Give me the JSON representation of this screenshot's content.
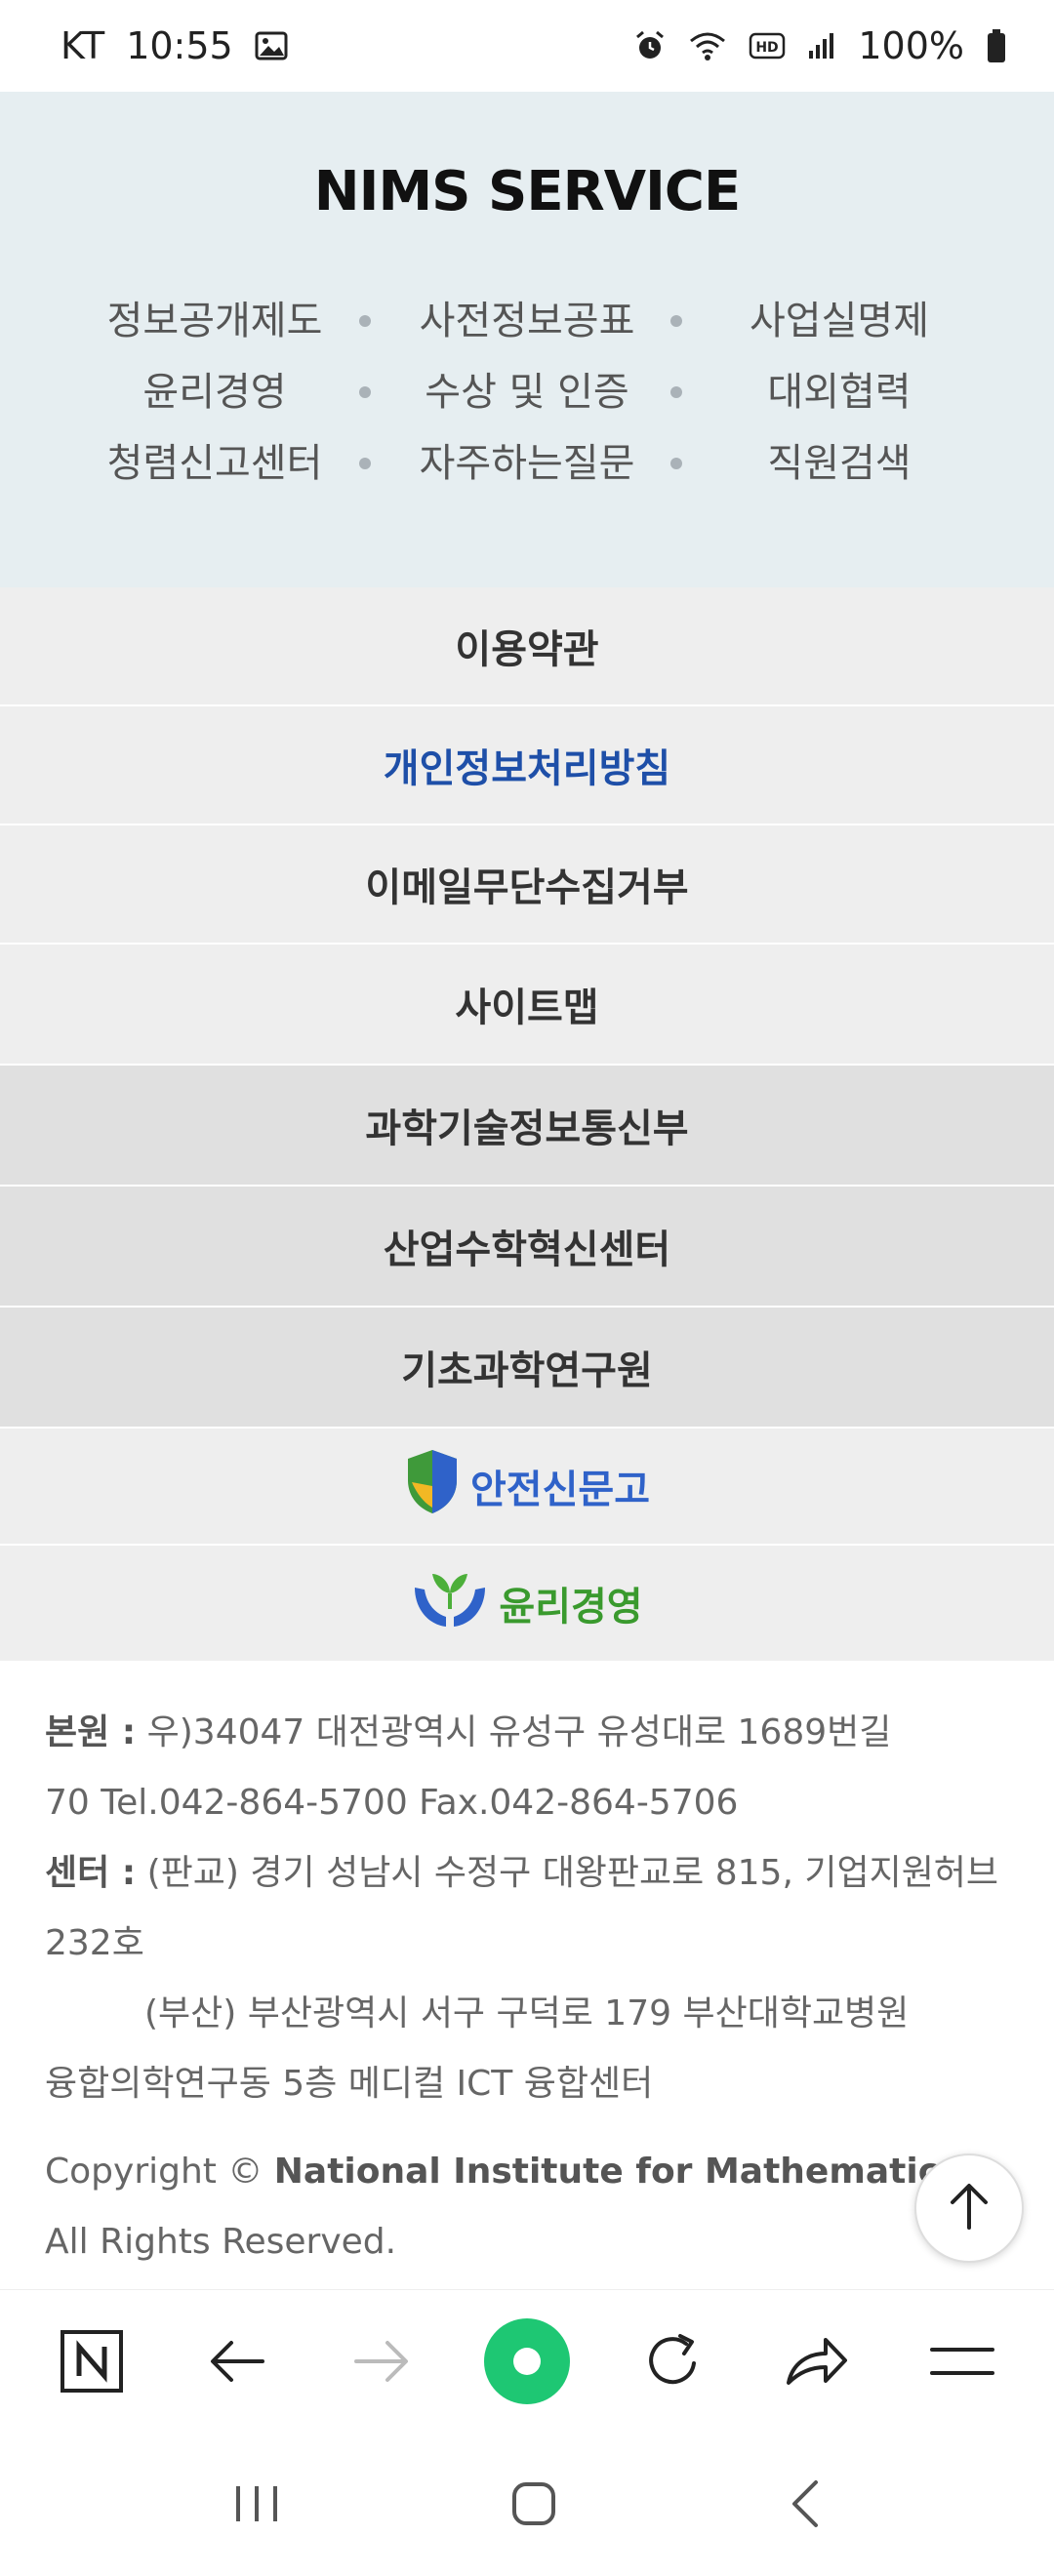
{
  "status_bar": {
    "carrier": "KT",
    "time": "10:55",
    "battery": "100%"
  },
  "services": {
    "title": "NIMS SERVICE",
    "rows": [
      [
        "정보공개제도",
        "사전정보공표",
        "사업실명제"
      ],
      [
        "윤리경영",
        "수상 및 인증",
        "대외협력"
      ],
      [
        "청렴신고센터",
        "자주하는질문",
        "직원검색"
      ]
    ]
  },
  "links": [
    {
      "label": "이용약관"
    },
    {
      "label": "개인정보처리방침"
    },
    {
      "label": "이메일무단수집거부"
    },
    {
      "label": "사이트맵"
    },
    {
      "label": "과학기술정보통신부"
    },
    {
      "label": "산업수학혁신센터"
    },
    {
      "label": "기초과학연구원"
    }
  ],
  "badges": {
    "safety": "안전신문고",
    "ethics": "윤리경영"
  },
  "footer": {
    "hq_label": "본원 :",
    "hq_line1": "우)34047 대전광역시 유성구 유성대로 1689번길",
    "hq_line2": "70  Tel.042-864-5700  Fax.042-864-5706",
    "center_label": "센터 :",
    "center_line1": "(판교) 경기 성남시 수정구 대왕판교로 815, 기업지원허브",
    "center_line2": "232호",
    "center_line3": "(부산) 부산광역시 서구 구덕로 179 부산대학교병원",
    "center_line4": "융합의학연구동 5층 메디컬 ICT 융합센터",
    "copyright_prefix": "Copyright © ",
    "copyright_org": "National Institute for Mathematical Sciences",
    "rights": "All Rights Reserved."
  },
  "colors": {
    "accent_blue": "#1e4fa8",
    "green": "#1ec773"
  }
}
